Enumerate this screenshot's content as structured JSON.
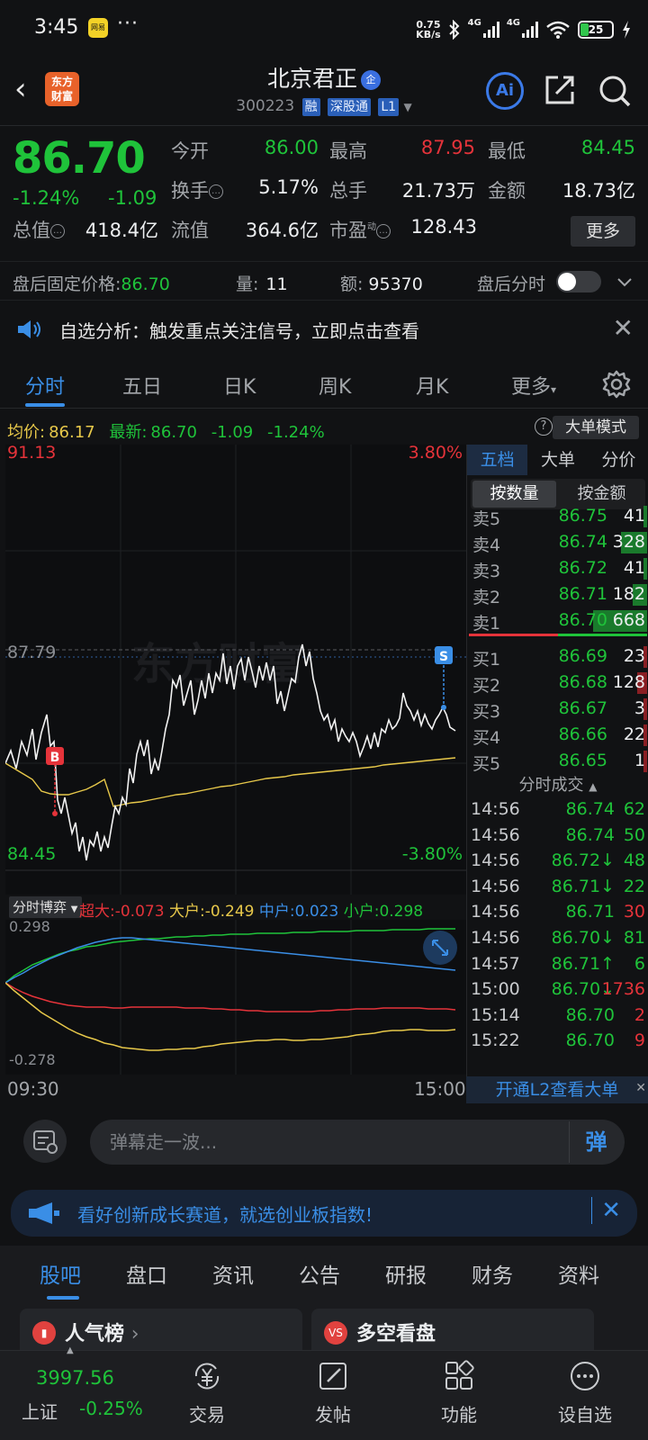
{
  "status": {
    "time": "3:45",
    "dots": "···",
    "net_speed_top": "0.75",
    "net_speed_bottom": "KB/s",
    "net_a": "4G",
    "net_b": "4G",
    "battery": "25",
    "app_icon_label": "网易"
  },
  "header": {
    "back": "‹",
    "logo_line1": "东方",
    "logo_line2": "财富",
    "title": "北京君正",
    "title_badge": "企",
    "code": "300223",
    "tags": [
      "融",
      "深股通",
      "L1"
    ],
    "ai_label": "Ai"
  },
  "quote": {
    "price": "86.70",
    "pct": "-1.24%",
    "chg": "-1.09",
    "open_label": "今开",
    "open": "86.00",
    "high_label": "最高",
    "high": "87.95",
    "low_label": "最低",
    "low": "84.45",
    "turnover_label": "换手",
    "turnover": "5.17%",
    "volume_label": "总手",
    "volume": "21.73万",
    "amount_label": "金额",
    "amount": "18.73亿",
    "mktcap_label": "总值",
    "mktcap": "418.4亿",
    "float_label": "流值",
    "float": "364.6亿",
    "pe_label": "市盈",
    "pe_sup": "动",
    "pe": "128.43",
    "more": "更多"
  },
  "after_hours": {
    "price_label": "盘后固定价格:",
    "price": "86.70",
    "qty_label": "量:",
    "qty": "11",
    "amt_label": "额:",
    "amt": "95370",
    "toggle_label": "盘后分时"
  },
  "notice": {
    "text": "自选分析：触发重点关注信号，立即点击查看"
  },
  "chart_tabs": [
    "分时",
    "五日",
    "日K",
    "周K",
    "月K",
    "更多"
  ],
  "avg": {
    "avg_label": "均价:",
    "avg": "86.17",
    "last_label": "最新:",
    "last": "86.70",
    "chg": "-1.09",
    "pct": "-1.24%",
    "mode": "大单模式"
  },
  "chart": {
    "top_price": "91.13",
    "top_pct": "3.80%",
    "bottom_price": "84.45",
    "bottom_pct": "-3.80%",
    "marker_price": "87.79",
    "buy_marker": "B",
    "sell_marker": "S",
    "watermark": "东方财富"
  },
  "fund": {
    "button": "分时博弈",
    "super_label": "超大:",
    "super": "-0.073",
    "big_label": "大户:",
    "big": "-0.249",
    "mid_label": "中户:",
    "mid": "0.023",
    "small_label": "小户:",
    "small": "0.298",
    "top_val": "0.298",
    "bottom_val": "-0.278",
    "time_start": "09:30",
    "time_end": "15:00"
  },
  "book": {
    "tabs": [
      "五档",
      "大单",
      "分价"
    ],
    "subtabs": [
      "按数量",
      "按金额"
    ],
    "asks": [
      {
        "label": "卖5",
        "price": "86.75",
        "vol": "41",
        "share": 0.06
      },
      {
        "label": "卖4",
        "price": "86.74",
        "vol": "328",
        "share": 0.49
      },
      {
        "label": "卖3",
        "price": "86.72",
        "vol": "41",
        "share": 0.06
      },
      {
        "label": "卖2",
        "price": "86.71",
        "vol": "182",
        "share": 0.27
      },
      {
        "label": "卖1",
        "price": "86.70",
        "vol": "668",
        "share": 1.0
      }
    ],
    "bids": [
      {
        "label": "买1",
        "price": "86.69",
        "vol": "23",
        "share": 0.03
      },
      {
        "label": "买2",
        "price": "86.68",
        "vol": "128",
        "share": 0.19
      },
      {
        "label": "买3",
        "price": "86.67",
        "vol": "3",
        "share": 0.01
      },
      {
        "label": "买4",
        "price": "86.66",
        "vol": "22",
        "share": 0.03
      },
      {
        "label": "买5",
        "price": "86.65",
        "vol": "1",
        "share": 0.01
      }
    ],
    "trades_title": "分时成交",
    "trades": [
      {
        "time": "14:56",
        "price": "86.74",
        "vol": "62",
        "color": "green"
      },
      {
        "time": "14:56",
        "price": "86.74",
        "vol": "50",
        "color": "green"
      },
      {
        "time": "14:56",
        "price": "86.72↓",
        "vol": "48",
        "color": "green"
      },
      {
        "time": "14:56",
        "price": "86.71↓",
        "vol": "22",
        "color": "green"
      },
      {
        "time": "14:56",
        "price": "86.71",
        "vol": "30",
        "color": "red"
      },
      {
        "time": "14:56",
        "price": "86.70↓",
        "vol": "81",
        "color": "green"
      },
      {
        "time": "14:57",
        "price": "86.71↑",
        "vol": "6",
        "color": "green"
      },
      {
        "time": "15:00",
        "price": "86.70↓",
        "vol": "1736",
        "color": "red"
      },
      {
        "time": "15:14",
        "price": "86.70",
        "vol": "2",
        "color": "red"
      },
      {
        "time": "15:22",
        "price": "86.70",
        "vol": "9",
        "color": "red"
      }
    ],
    "l2": "开通L2查看大单"
  },
  "barrage": {
    "placeholder": "弹幕走一波...",
    "send": "弹"
  },
  "promo": {
    "text": "看好创新成长赛道，就选创业板指数!"
  },
  "bottom_tabs": [
    "股吧",
    "盘口",
    "资讯",
    "公告",
    "研报",
    "财务",
    "资料"
  ],
  "cards": [
    {
      "title": "人气榜",
      "arrow": "›",
      "icon": "▮"
    },
    {
      "title": "多空看盘",
      "icon": "VS"
    }
  ],
  "nav": {
    "index_value": "3997.56",
    "index_name": "上证",
    "index_pct": "-0.25%",
    "items": [
      "交易",
      "发帖",
      "功能",
      "设自选"
    ]
  },
  "colors": {
    "up": "#e5333a",
    "down": "#1fc33a",
    "accent": "#3a8ee6",
    "avg_line": "#e7c84a"
  }
}
